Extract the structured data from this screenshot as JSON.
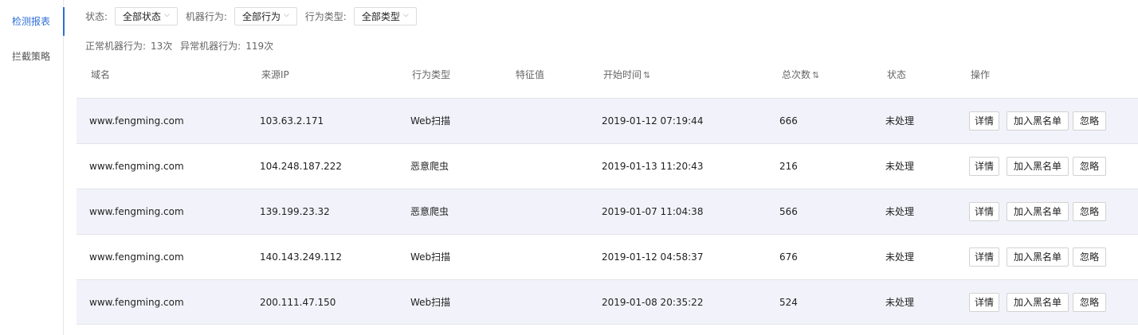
{
  "sidebar": {
    "items": [
      {
        "label": "检测报表",
        "active": true
      },
      {
        "label": "拦截策略",
        "active": false
      }
    ]
  },
  "filters": {
    "status_label": "状态:",
    "status_value": "全部状态",
    "machine_label": "机器行为:",
    "machine_value": "全部行为",
    "type_label": "行为类型:",
    "type_value": "全部类型"
  },
  "stats": {
    "normal_label": "正常机器行为:",
    "normal_value": "13次",
    "abnormal_label": "异常机器行为:",
    "abnormal_value": "119次"
  },
  "table": {
    "headers": {
      "domain": "域名",
      "ip": "来源IP",
      "type": "行为类型",
      "feature": "特征值",
      "start": "开始时间",
      "total": "总次数",
      "status": "状态",
      "action": "操作"
    },
    "sort_icon": "⇅",
    "actions": {
      "detail": "详情",
      "blacklist": "加入黑名单",
      "ignore": "忽略"
    },
    "rows": [
      {
        "domain": "www.fengming.com",
        "ip": "103.63.2.171",
        "type": "Web扫描",
        "feature": "",
        "start": "2019-01-12 07:19:44",
        "total": "666",
        "status": "未处理"
      },
      {
        "domain": "www.fengming.com",
        "ip": "104.248.187.222",
        "type": "恶意爬虫",
        "feature": "",
        "start": "2019-01-13 11:20:43",
        "total": "216",
        "status": "未处理"
      },
      {
        "domain": "www.fengming.com",
        "ip": "139.199.23.32",
        "type": "恶意爬虫",
        "feature": "",
        "start": "2019-01-07 11:04:38",
        "total": "566",
        "status": "未处理"
      },
      {
        "domain": "www.fengming.com",
        "ip": "140.143.249.112",
        "type": "Web扫描",
        "feature": "",
        "start": "2019-01-12 04:58:37",
        "total": "676",
        "status": "未处理"
      },
      {
        "domain": "www.fengming.com",
        "ip": "200.111.47.150",
        "type": "Web扫描",
        "feature": "",
        "start": "2019-01-08 20:35:22",
        "total": "524",
        "status": "未处理"
      }
    ]
  },
  "colors": {
    "accent": "#2f6ed8",
    "row_alt": "#f2f3fa"
  }
}
